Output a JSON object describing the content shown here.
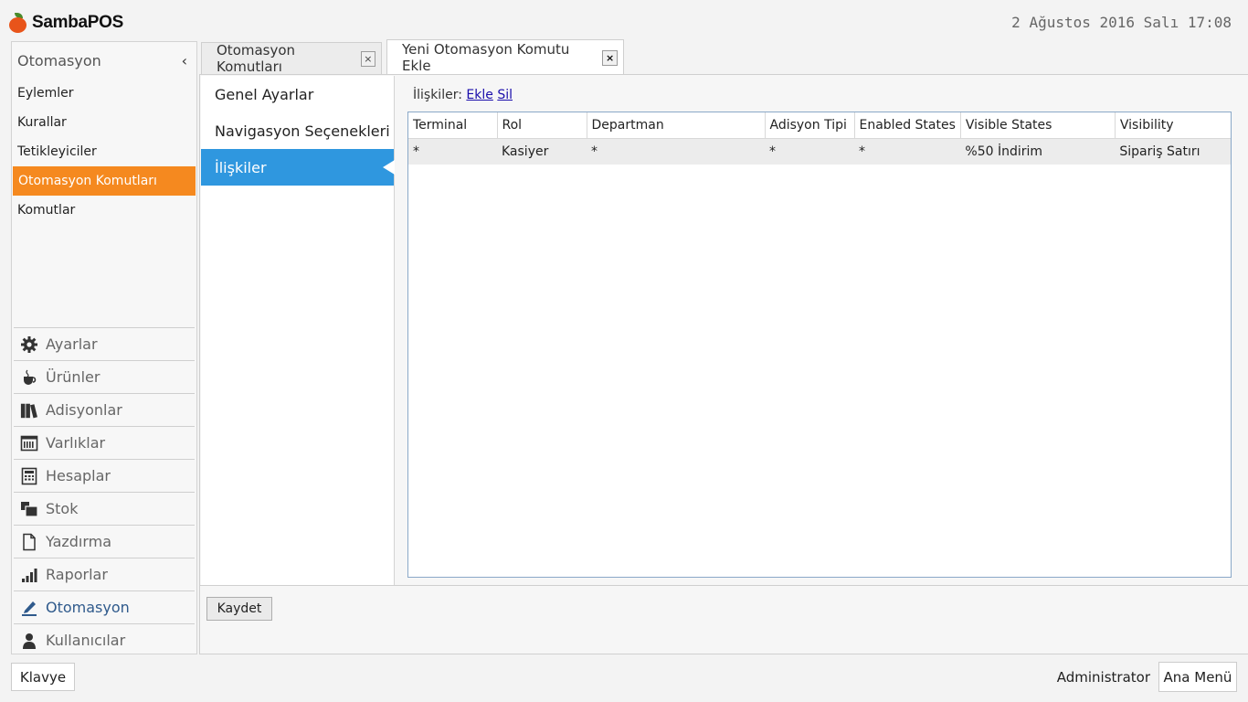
{
  "app": {
    "title": "SambaPOS",
    "datetime": "2 Ağustos 2016 Salı 17:08"
  },
  "sidebar": {
    "header": "Otomasyon",
    "collapse_icon": "chevron-left-icon",
    "items": [
      {
        "label": "Eylemler",
        "active": false
      },
      {
        "label": "Kurallar",
        "active": false
      },
      {
        "label": "Tetikleyiciler",
        "active": false
      },
      {
        "label": "Otomasyon Komutları",
        "active": true
      },
      {
        "label": "Komutlar",
        "active": false
      }
    ],
    "nav": [
      {
        "label": "Ayarlar",
        "icon": "gear-icon"
      },
      {
        "label": "Ürünler",
        "icon": "cup-icon"
      },
      {
        "label": "Adisyonlar",
        "icon": "books-icon"
      },
      {
        "label": "Varlıklar",
        "icon": "calendar-grid-icon"
      },
      {
        "label": "Hesaplar",
        "icon": "calculator-icon"
      },
      {
        "label": "Stok",
        "icon": "stack-icon"
      },
      {
        "label": "Yazdırma",
        "icon": "document-icon"
      },
      {
        "label": "Raporlar",
        "icon": "bar-chart-icon"
      },
      {
        "label": "Otomasyon",
        "icon": "pen-icon",
        "active": true
      },
      {
        "label": "Kullanıcılar",
        "icon": "user-icon"
      }
    ]
  },
  "tabs": [
    {
      "label": "Otomasyon Komutları",
      "close": "×"
    },
    {
      "label": "Yeni Otomasyon Komutu Ekle",
      "close": "×",
      "active": true
    }
  ],
  "sections": [
    {
      "label": "Genel Ayarlar"
    },
    {
      "label": "Navigasyon Seçenekleri"
    },
    {
      "label": "İlişkiler",
      "active": true
    }
  ],
  "relations": {
    "label": "İlişkiler:",
    "add_link": "Ekle",
    "delete_link": "Sil",
    "columns": [
      "Terminal",
      "Rol",
      "Departman",
      "Adisyon Tipi",
      "Enabled States",
      "Visible States",
      "Visibility"
    ],
    "rows": [
      [
        "*",
        "Kasiyer",
        "*",
        "*",
        "*",
        "%50 İndirim",
        "Sipariş Satırı"
      ]
    ]
  },
  "save_button": "Kaydet",
  "footer": {
    "keyboard_button": "Klavye",
    "user": "Administrator",
    "main_menu_button": "Ana Menü"
  },
  "colors": {
    "accent": "#f5891f",
    "selection": "#2f97df",
    "nav_active": "#2f5a8c"
  }
}
